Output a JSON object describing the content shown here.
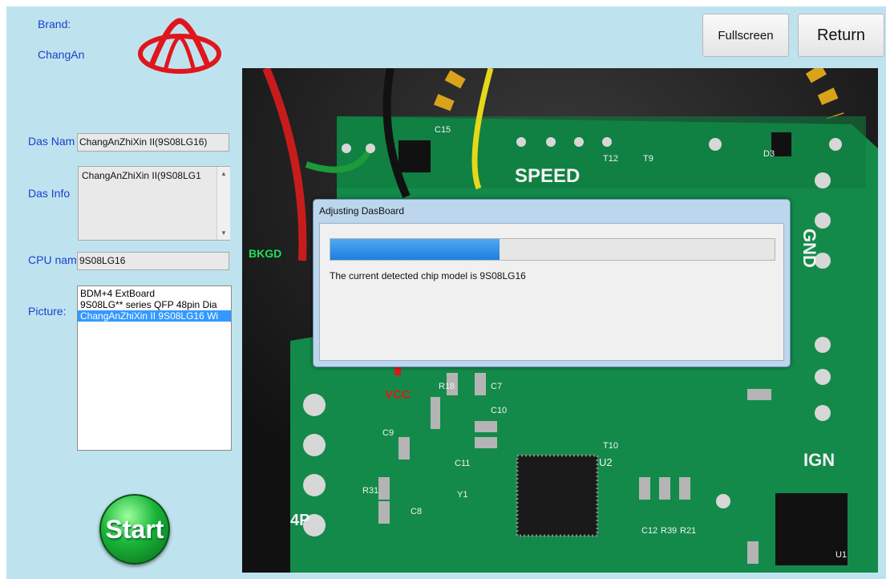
{
  "brand": {
    "label": "Brand:",
    "name": "ChangAn",
    "logo_color": "#e0161c"
  },
  "fields": {
    "das_name_label": "Das Nam",
    "das_name_value": "ChangAnZhiXin II(9S08LG16)",
    "das_info_label": "Das Info",
    "das_info_value": "ChangAnZhiXin II(9S08LG1",
    "cpu_name_label": "CPU nam",
    "cpu_name_value": "9S08LG16",
    "picture_label": "Picture:"
  },
  "picture_list": {
    "items": [
      "BDM+4 ExtBoard",
      "9S08LG** series QFP 48pin Dia",
      "ChangAnZhiXin II 9S08LG16 Wi"
    ],
    "selected_index": 2
  },
  "buttons": {
    "fullscreen": "Fullscreen",
    "return": "Return",
    "start": "Start"
  },
  "board_labels": {
    "speed": "SPEED",
    "bkgd": "BKGD",
    "gnd": "GND",
    "vcc": "VCC",
    "ign": "IGN",
    "conn": "4P",
    "d3": "D3",
    "t12": "T12",
    "t9": "T9",
    "t10": "T10",
    "u2": "U2",
    "u1": "U1",
    "c15": "C15",
    "c9": "C9",
    "c8": "C8",
    "c10": "C10",
    "c11": "C11",
    "c12": "C12",
    "c7": "C7",
    "r18": "R18",
    "r31": "R31",
    "r39": "R39",
    "r21": "R21",
    "y1": "Y1"
  },
  "dialog": {
    "title": "Adjusting DasBoard",
    "message": "The current detected chip model is 9S08LG16",
    "progress_percent": 38
  },
  "colors": {
    "panel_bg": "#bfe3ee",
    "label_blue": "#1a3fd0",
    "selection": "#3399ff",
    "progress": "#2a8ae8",
    "pcb_green": "#138a4a",
    "start_green": "#1da33a"
  }
}
